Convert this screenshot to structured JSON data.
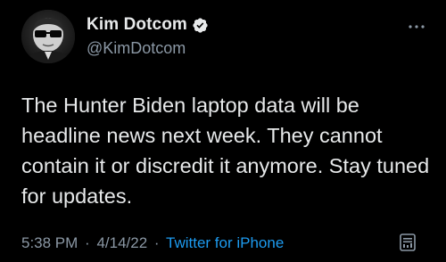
{
  "author": {
    "display_name": "Kim Dotcom",
    "handle": "@KimDotcom",
    "verified": true,
    "avatar": "kim-dotcom-avatar"
  },
  "tweet": {
    "text": "The Hunter Biden laptop data will be headline news next week. They cannot contain it or discredit it anymore. Stay tuned for updates.",
    "time": "5:38 PM",
    "separator": "·",
    "date": "4/14/22",
    "source": "Twitter for iPhone"
  },
  "icons": {
    "verified": "verified-badge-icon",
    "more": "more-options-icon",
    "analytics": "tweet-analytics-icon"
  },
  "colors": {
    "background": "#000000",
    "text_primary": "#e7e9ea",
    "text_secondary": "#8b98a5",
    "link": "#1d9bf0",
    "verified_badge": "#e7e9ea"
  }
}
